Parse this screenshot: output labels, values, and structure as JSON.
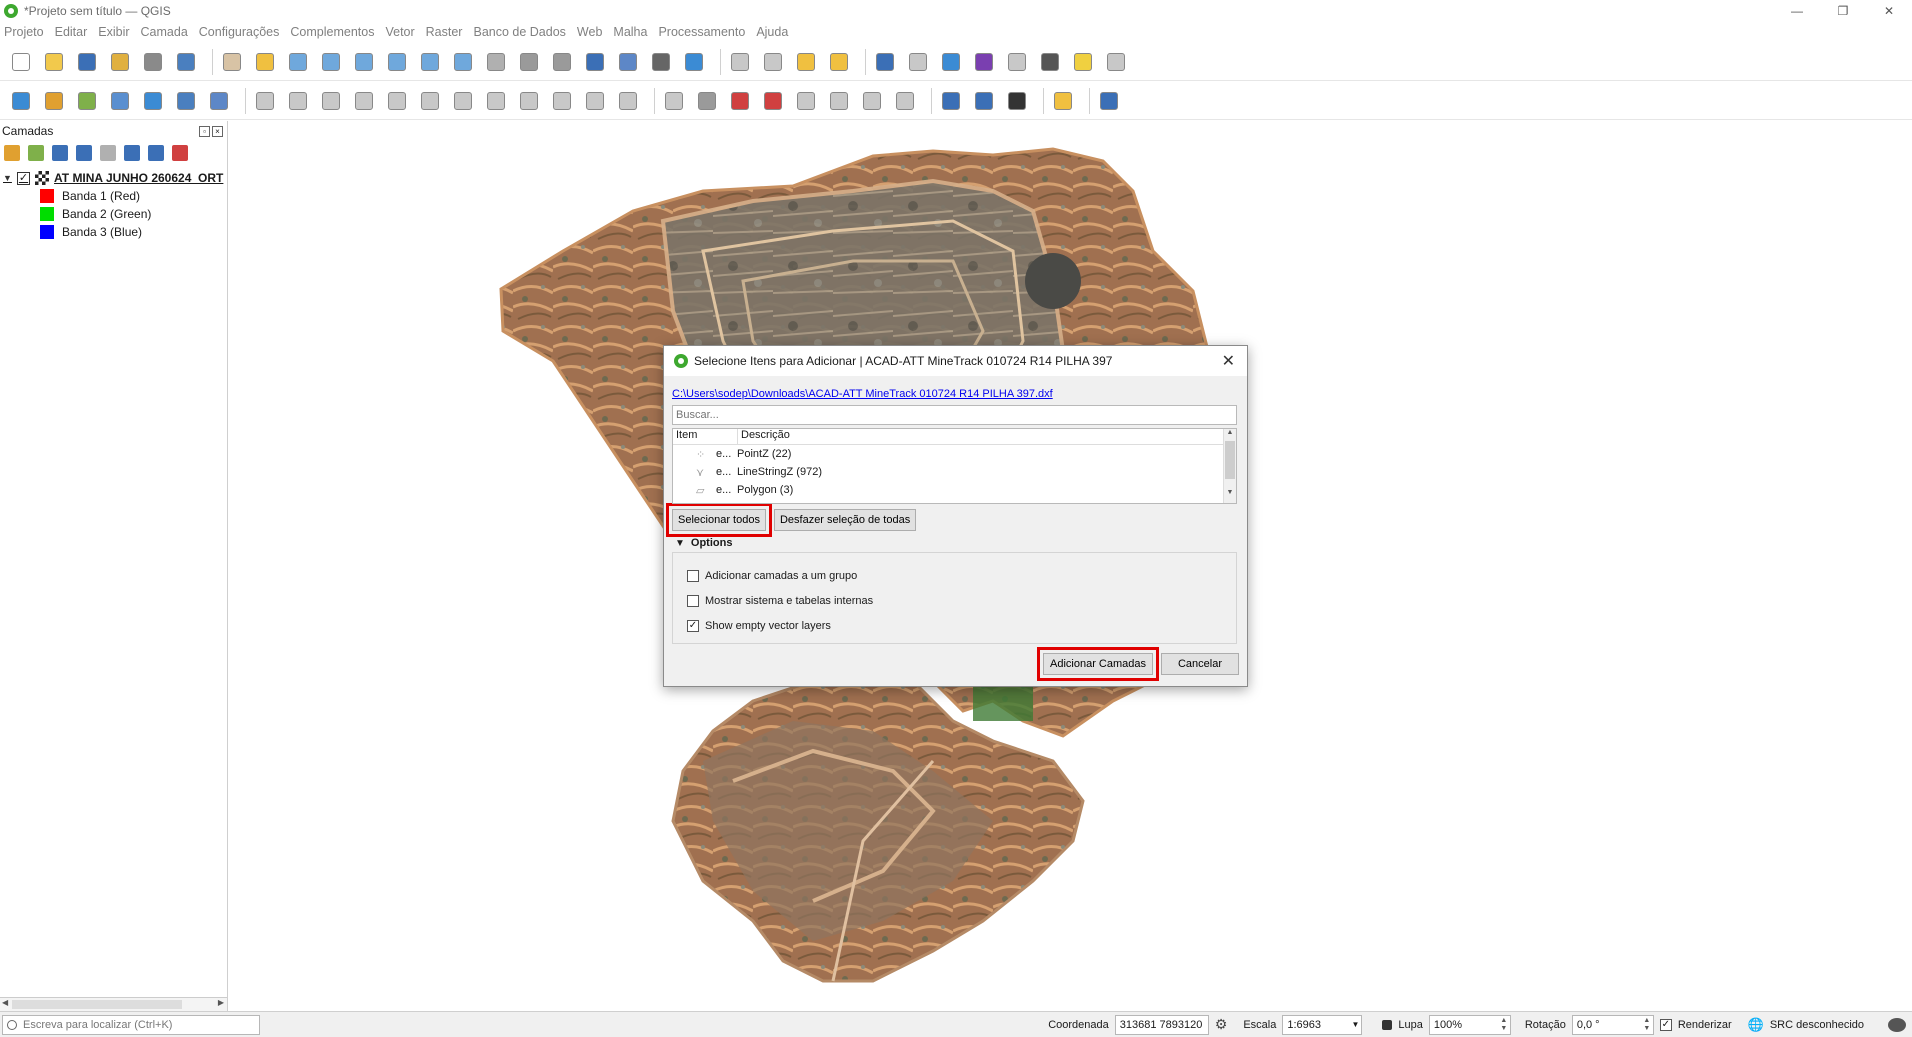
{
  "window": {
    "title": "*Projeto sem título — QGIS",
    "controls": [
      "—",
      "❐",
      "✕"
    ]
  },
  "menu": [
    "Projeto",
    "Editar",
    "Exibir",
    "Camada",
    "Configurações",
    "Complementos",
    "Vetor",
    "Raster",
    "Banco de Dados",
    "Web",
    "Malha",
    "Processamento",
    "Ajuda"
  ],
  "toolbar1": [
    {
      "name": "new-project-icon",
      "color": "#ffffff"
    },
    {
      "name": "open-project-icon",
      "color": "#f2c94c"
    },
    {
      "name": "save-project-icon",
      "color": "#3b6fb6"
    },
    {
      "name": "new-print-layout-icon",
      "color": "#e0b040"
    },
    {
      "name": "layout-manager-icon",
      "color": "#8a8a8a"
    },
    {
      "name": "style-manager-icon",
      "color": "#4a7fbf"
    },
    {
      "sep": true
    },
    {
      "name": "pan-icon",
      "color": "#d8c3a5"
    },
    {
      "name": "pan-to-selection-icon",
      "color": "#f0c040"
    },
    {
      "name": "zoom-in-icon",
      "color": "#6fa8dc"
    },
    {
      "name": "zoom-out-icon",
      "color": "#6fa8dc"
    },
    {
      "name": "zoom-full-icon",
      "color": "#6fa8dc"
    },
    {
      "name": "zoom-to-selection-icon",
      "color": "#6fa8dc"
    },
    {
      "name": "zoom-to-layer-icon",
      "color": "#6fa8dc"
    },
    {
      "name": "zoom-native-icon",
      "color": "#6fa8dc"
    },
    {
      "name": "zoom-last-icon",
      "color": "#b0b0b0"
    },
    {
      "name": "new-map-view-icon",
      "color": "#9a9a9a"
    },
    {
      "name": "new-3d-view-icon",
      "color": "#9a9a9a"
    },
    {
      "name": "temporal-controller-icon",
      "color": "#3b6fb6"
    },
    {
      "name": "bookmarks-icon",
      "color": "#5d87c7"
    },
    {
      "name": "clock-icon",
      "color": "#666666"
    },
    {
      "name": "refresh-icon",
      "color": "#3b8bd4"
    },
    {
      "sep": true
    },
    {
      "name": "select-features-icon",
      "color": "#c8c8c8"
    },
    {
      "name": "select-by-value-icon",
      "color": "#c8c8c8"
    },
    {
      "name": "deselect-icon",
      "color": "#f0c040"
    },
    {
      "name": "select-by-location-icon",
      "color": "#f0c040"
    },
    {
      "sep": true
    },
    {
      "name": "identify-icon",
      "color": "#3b6fb6"
    },
    {
      "name": "attribute-table-icon",
      "color": "#c8c8c8"
    },
    {
      "name": "toolbox-icon",
      "color": "#3b8bd4"
    },
    {
      "name": "statistics-icon",
      "color": "#7a3fb0"
    },
    {
      "name": "field-calculator-icon",
      "color": "#c8c8c8"
    },
    {
      "name": "measure-icon",
      "color": "#555555"
    },
    {
      "name": "map-tips-icon",
      "color": "#f0d040"
    },
    {
      "name": "annotation-icon",
      "color": "#c8c8c8"
    }
  ],
  "toolbar2": [
    {
      "name": "data-source-manager-icon",
      "color": "#3b8bd4"
    },
    {
      "name": "new-geopackage-icon",
      "color": "#e0a030"
    },
    {
      "name": "new-shapefile-icon",
      "color": "#7fb04a"
    },
    {
      "name": "new-spatialite-icon",
      "color": "#5a8fd0"
    },
    {
      "name": "new-temp-layer-icon",
      "color": "#3b8bd4"
    },
    {
      "name": "add-raster-icon",
      "color": "#4a7fbf"
    },
    {
      "name": "add-mesh-icon",
      "color": "#5d87c7"
    },
    {
      "sep": true
    },
    {
      "name": "current-edits-icon",
      "color": "#c8c8c8"
    },
    {
      "name": "toggle-editing-icon",
      "color": "#c8c8c8"
    },
    {
      "name": "save-edits-icon",
      "color": "#c8c8c8"
    },
    {
      "name": "digitize-icon",
      "color": "#c8c8c8"
    },
    {
      "name": "vertex-tool-icon",
      "color": "#c8c8c8"
    },
    {
      "name": "modify-attributes-icon",
      "color": "#c8c8c8"
    },
    {
      "name": "delete-selected-icon",
      "color": "#c8c8c8"
    },
    {
      "name": "cut-features-icon",
      "color": "#c8c8c8"
    },
    {
      "name": "copy-features-icon",
      "color": "#c8c8c8"
    },
    {
      "name": "paste-features-icon",
      "color": "#c8c8c8"
    },
    {
      "name": "undo-icon",
      "color": "#c8c8c8"
    },
    {
      "name": "redo-icon",
      "color": "#c8c8c8"
    },
    {
      "sep": true
    },
    {
      "name": "label-toolbar-icon",
      "color": "#c8c8c8"
    },
    {
      "name": "label-pin-icon",
      "color": "#9a9a9a"
    },
    {
      "name": "label-highlight-icon",
      "color": "#d04040"
    },
    {
      "name": "label-abc-icon",
      "color": "#d04040"
    },
    {
      "name": "label-move-icon",
      "color": "#c8c8c8"
    },
    {
      "name": "label-rotate-icon",
      "color": "#c8c8c8"
    },
    {
      "name": "label-change-icon",
      "color": "#c8c8c8"
    },
    {
      "name": "label-show-hide-icon",
      "color": "#c8c8c8"
    },
    {
      "sep": true
    },
    {
      "name": "globe-plus-icon",
      "color": "#3b6fb6"
    },
    {
      "name": "globe-search-icon",
      "color": "#3b6fb6"
    },
    {
      "name": "globe-cloud-icon",
      "color": "#333333"
    },
    {
      "sep": true
    },
    {
      "name": "python-console-icon",
      "color": "#f0c040"
    },
    {
      "sep": true
    },
    {
      "name": "help-icon",
      "color": "#3b6fb6"
    }
  ],
  "layers_panel": {
    "title": "Camadas",
    "tools": [
      {
        "name": "open-styling-icon",
        "color": "#e0a030"
      },
      {
        "name": "add-group-icon",
        "color": "#7fb04a"
      },
      {
        "name": "manage-visibility-icon",
        "color": "#3b6fb6"
      },
      {
        "name": "filter-legend-icon",
        "color": "#3b6fb6"
      },
      {
        "name": "filter-expression-icon",
        "color": "#b0b0b0"
      },
      {
        "name": "expand-all-icon",
        "color": "#3b6fb6"
      },
      {
        "name": "collapse-all-icon",
        "color": "#3b6fb6"
      },
      {
        "name": "remove-layer-icon",
        "color": "#d04040"
      }
    ],
    "layer": {
      "name": "AT MINA JUNHO 260624_ORT",
      "checked": "✓"
    },
    "bands": [
      {
        "label": "Banda 1 (Red)",
        "color": "#ff0000"
      },
      {
        "label": "Banda 2 (Green)",
        "color": "#00dd00"
      },
      {
        "label": "Banda 3 (Blue)",
        "color": "#0000ff"
      }
    ]
  },
  "dialog": {
    "title": "Selecione Itens para Adicionar | ACAD-ATT MineTrack 010724 R14 PILHA 397",
    "file_link": "C:\\Users\\sodep\\Downloads\\ACAD-ATT MineTrack 010724 R14 PILHA 397.dxf",
    "search_placeholder": "Buscar...",
    "columns": [
      "Item",
      "Descrição"
    ],
    "items": [
      {
        "icon": "⁘",
        "name": "e...",
        "description": "PointZ (22)"
      },
      {
        "icon": "⋎",
        "name": "e...",
        "description": "LineStringZ (972)"
      },
      {
        "icon": "▱",
        "name": "e...",
        "description": "Polygon (3)"
      }
    ],
    "select_all_label": "Selecionar todos",
    "deselect_all_label": "Desfazer seleção de todas",
    "options_title": "Options",
    "options": [
      {
        "label": "Adicionar camadas a um grupo",
        "checked": ""
      },
      {
        "label": "Mostrar sistema e tabelas internas",
        "checked": ""
      },
      {
        "label": "Show empty vector layers",
        "checked": "✓"
      }
    ],
    "add_layers_label": "Adicionar Camadas",
    "cancel_label": "Cancelar",
    "close": "✕"
  },
  "statusbar": {
    "locator_placeholder": "Escreva para localizar (Ctrl+K)",
    "coord_label": "Coordenada",
    "coord_value": "313681 7893120",
    "scale_label": "Escala",
    "scale_value": "1:6963",
    "magnifier_label": "Lupa",
    "magnifier_value": "100%",
    "rotation_label": "Rotação",
    "rotation_value": "0,0 °",
    "render_label": "Renderizar",
    "render_checked": "✓",
    "crs_label": "SRC desconhecido"
  }
}
